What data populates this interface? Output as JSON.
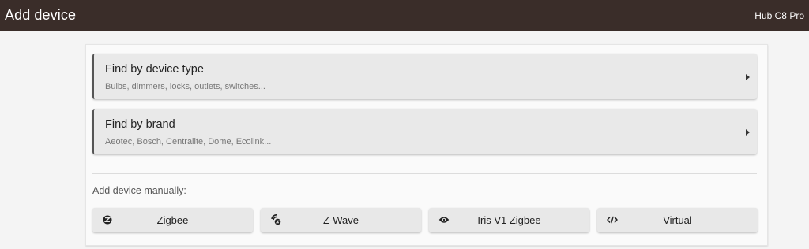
{
  "header": {
    "title": "Add device",
    "hub_name": "Hub C8 Pro"
  },
  "finders": [
    {
      "title": "Find by device type",
      "subtitle": "Bulbs, dimmers, locks, outlets, switches..."
    },
    {
      "title": "Find by brand",
      "subtitle": "Aeotec, Bosch, Centralite, Dome, Ecolink..."
    }
  ],
  "manual": {
    "label": "Add device manually:",
    "buttons": [
      {
        "label": "Zigbee",
        "icon": "zigbee-icon"
      },
      {
        "label": "Z-Wave",
        "icon": "zwave-icon"
      },
      {
        "label": "Iris V1 Zigbee",
        "icon": "eye-icon"
      },
      {
        "label": "Virtual",
        "icon": "code-icon"
      }
    ]
  },
  "colors": {
    "topbar": "#3a2d29",
    "card": "#e9e9e9",
    "accent_border": "#555555"
  }
}
